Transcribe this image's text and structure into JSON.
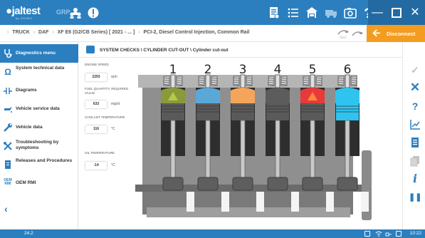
{
  "app": {
    "logo_text": "jaltest",
    "logo_sub": "by COJALI",
    "group_label": "GRP"
  },
  "breadcrumb": [
    "TRUCK",
    "DAF",
    "XF E6 (G2/CB Series) [ 2021 - ... ]",
    "PCI-2, Diesel Control Injection, Common Rail"
  ],
  "disconnect_label": "Disconnect",
  "sidebar": {
    "items": [
      {
        "label": "Diagnostics menu",
        "icon": "stethoscope-icon",
        "active": true
      },
      {
        "label": "System technical data",
        "icon": "ohm-icon"
      },
      {
        "label": "Diagrams",
        "icon": "wiring-diagram-icon"
      },
      {
        "label": "Vehicle service data",
        "icon": "oil-can-icon"
      },
      {
        "label": "Vehicle data",
        "icon": "wrench-icon"
      },
      {
        "label": "Troubleshooting by symptoms",
        "icon": "tools-icon"
      },
      {
        "label": "Releases and Procedures",
        "icon": "document-icon"
      },
      {
        "label": "OEM RMI",
        "icon": "oem-rmi-icon",
        "icon_text": "OEM RMI"
      }
    ]
  },
  "content": {
    "header": "SYSTEM CHECKS \\ CYLINDER CUT-OUT \\ Cylinder cut-out"
  },
  "readings": [
    {
      "label": "ENGINE SPEED",
      "value": "2293",
      "unit": "rpm"
    },
    {
      "label": "FUEL QUANTITY, REQUIRED VALUE",
      "value": "633",
      "unit": "mg/st"
    },
    {
      "label": "COOLANT TEMPERATURE",
      "value": "116",
      "unit": "°C"
    },
    {
      "label": "OIL TEMPERATURE",
      "value": "-14",
      "unit": "°C"
    }
  ],
  "cylinders": [
    {
      "number": "1",
      "top_color": "#8a9a3a",
      "piston_color": "#5a5a5a",
      "has_spray": true
    },
    {
      "number": "2",
      "top_color": "#5aa8d8",
      "piston_color": "#5a5a5a",
      "has_spray": false
    },
    {
      "number": "3",
      "top_color": "#f5a55a",
      "piston_color": "#5a5a5a",
      "has_spray": false
    },
    {
      "number": "4",
      "top_color": "#5c5c5c",
      "piston_color": "#5a5a5a",
      "has_spray": false
    },
    {
      "number": "5",
      "top_color": "#e83a3a",
      "piston_color": "#5a5a5a",
      "has_spray": true
    },
    {
      "number": "6",
      "top_color": "#2fc4f0",
      "piston_color": "#2fc4f0",
      "has_spray": false
    }
  ],
  "right_tools": [
    {
      "icon": "check-icon",
      "glyph": "✓",
      "enabled": false
    },
    {
      "icon": "close-icon",
      "glyph": "✕",
      "enabled": true
    },
    {
      "icon": "help-icon",
      "glyph": "?",
      "enabled": true
    },
    {
      "icon": "graph-icon",
      "glyph": "📈",
      "enabled": true
    },
    {
      "icon": "list-icon",
      "glyph": "☰",
      "enabled": true
    },
    {
      "icon": "copy-icon",
      "glyph": "❐",
      "enabled": false
    },
    {
      "icon": "info-icon",
      "glyph": "i",
      "enabled": true
    },
    {
      "icon": "pause-icon",
      "glyph": "❚❚",
      "enabled": true
    }
  ],
  "status": {
    "version": "24.2",
    "time": "10:22"
  },
  "colors": {
    "brand_blue": "#2b7fbf",
    "disconnect_orange": "#f39c1f"
  }
}
